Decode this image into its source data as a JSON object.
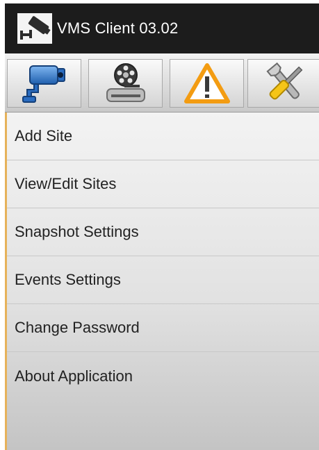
{
  "app": {
    "title": "VMS Client 03.02",
    "icon": "cctv-camera-icon"
  },
  "toolbar": {
    "buttons": [
      {
        "name": "live-camera",
        "icon": "security-camera-icon"
      },
      {
        "name": "playback",
        "icon": "film-reel-drive-icon"
      },
      {
        "name": "events",
        "icon": "warning-triangle-icon"
      },
      {
        "name": "settings",
        "icon": "tools-wrench-screwdriver-icon"
      }
    ]
  },
  "menu": {
    "items": [
      {
        "label": "Add Site"
      },
      {
        "label": "View/Edit Sites"
      },
      {
        "label": "Snapshot Settings"
      },
      {
        "label": "Events Settings"
      },
      {
        "label": "Change Password"
      },
      {
        "label": "About Application"
      }
    ]
  },
  "colors": {
    "titlebar": "#1c1c1c",
    "accent_edge": "#e6b25a",
    "warning": "#f39c12"
  }
}
